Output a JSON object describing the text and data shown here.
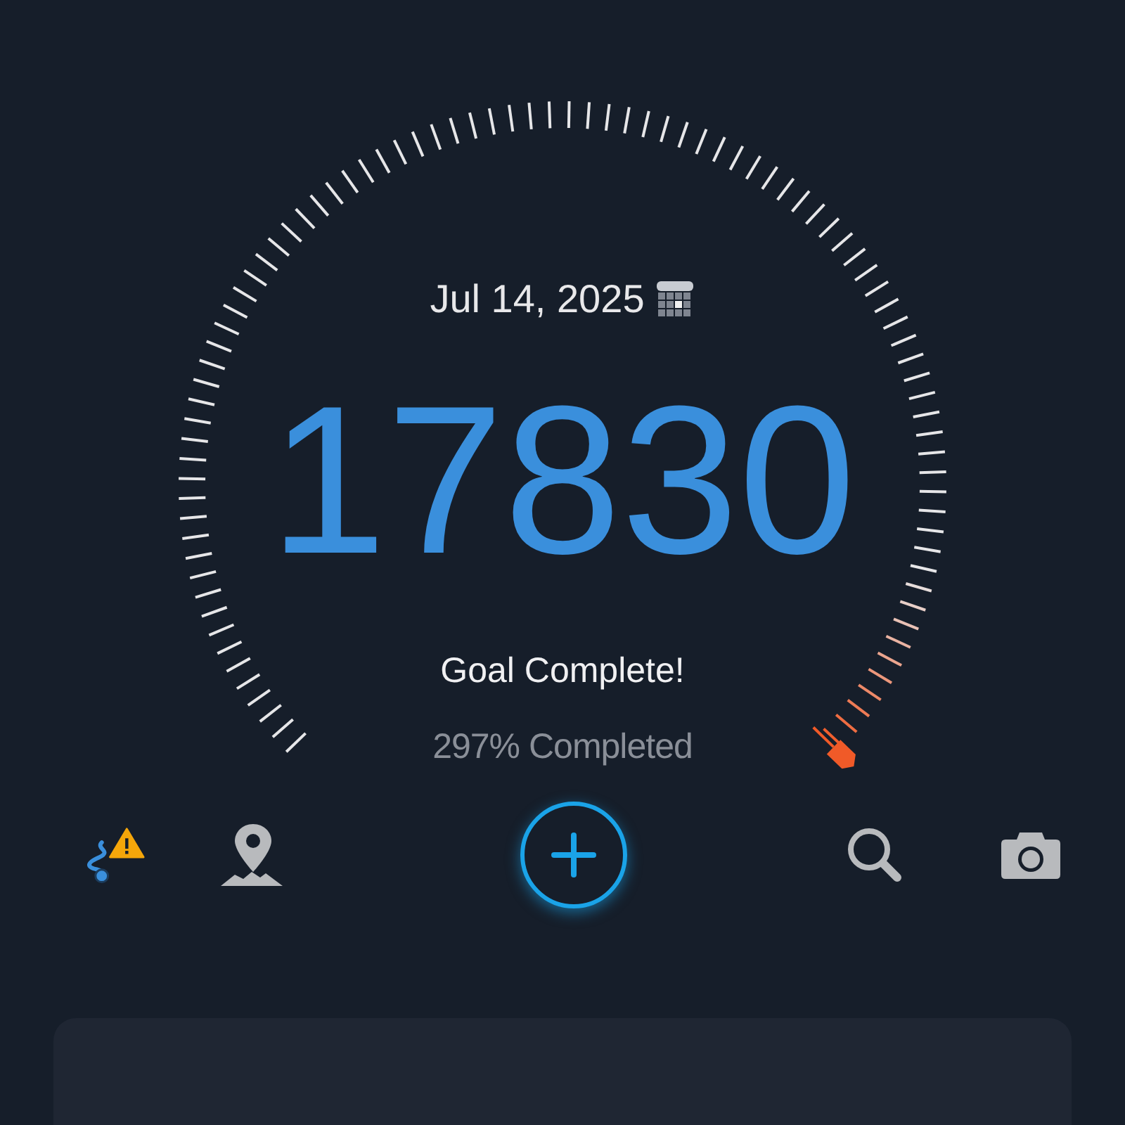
{
  "gauge": {
    "date": "Jul 14, 2025",
    "steps": "17830",
    "status": "Goal Complete!",
    "percent_text": "297% Completed"
  },
  "toolbar": {
    "left": [
      {
        "kind": "routes",
        "selected": true
      },
      {
        "kind": "map",
        "selected": false
      }
    ],
    "add_button": {
      "glow": true
    },
    "right": [
      {
        "kind": "search",
        "selected": false
      },
      {
        "kind": "camera",
        "selected": false
      }
    ]
  }
}
